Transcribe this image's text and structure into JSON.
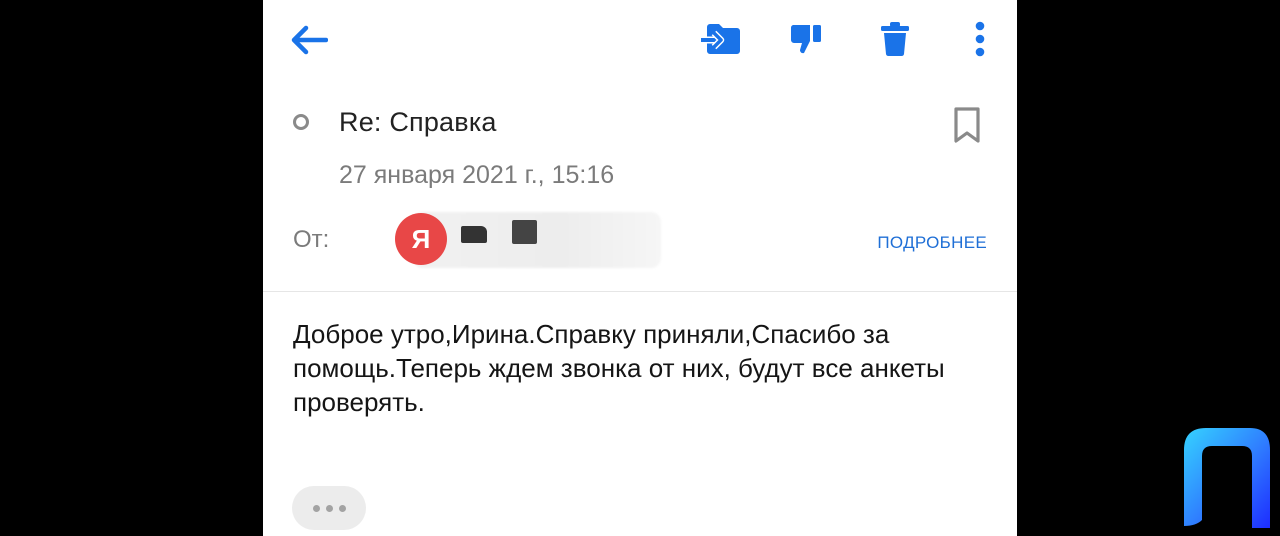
{
  "toolbar": {
    "back_icon": "arrow-left-icon",
    "move_icon": "move-to-folder-icon",
    "spam_icon": "thumbs-down-icon",
    "delete_icon": "trash-icon",
    "more_icon": "vertical-dots-icon",
    "accent_color": "#1a73e8"
  },
  "message": {
    "subject": "Re: Справка",
    "date": "27 января 2021 г., 15:16",
    "from_label": "От:",
    "sender_initial": "Я",
    "details_label": "ПОДРОБНЕЕ",
    "body": "Доброе утро,Ирина.Справку приняли,Спасибо за помощь.Теперь ждем звонка от них, будут все анкеты проверять.",
    "avatar_color": "#e84747"
  },
  "expand_quoted_icon": "ellipsis-icon",
  "overlay_logo_icon": "channel-logo-icon"
}
